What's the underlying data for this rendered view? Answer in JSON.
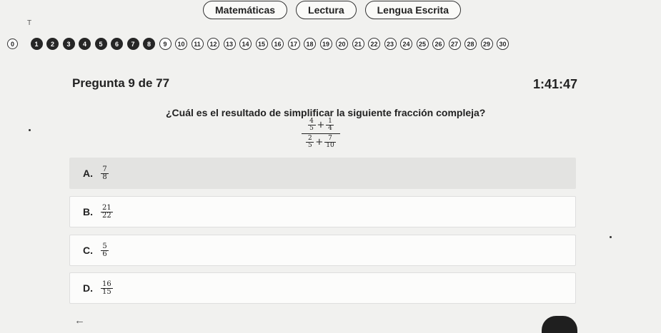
{
  "tabs": [
    "Matemáticas",
    "Lectura",
    "Lengua Escrita"
  ],
  "mark": "T",
  "progress": {
    "items": [
      {
        "label": "0",
        "state": "zero"
      },
      {
        "label": "1",
        "state": "done"
      },
      {
        "label": "2",
        "state": "done"
      },
      {
        "label": "3",
        "state": "done"
      },
      {
        "label": "4",
        "state": "done"
      },
      {
        "label": "5",
        "state": "done"
      },
      {
        "label": "6",
        "state": "done"
      },
      {
        "label": "7",
        "state": "done"
      },
      {
        "label": "8",
        "state": "done"
      },
      {
        "label": "9",
        "state": "pending"
      },
      {
        "label": "10",
        "state": "pending"
      },
      {
        "label": "11",
        "state": "pending"
      },
      {
        "label": "12",
        "state": "pending"
      },
      {
        "label": "13",
        "state": "pending"
      },
      {
        "label": "14",
        "state": "pending"
      },
      {
        "label": "15",
        "state": "pending"
      },
      {
        "label": "16",
        "state": "pending"
      },
      {
        "label": "17",
        "state": "pending"
      },
      {
        "label": "18",
        "state": "pending"
      },
      {
        "label": "19",
        "state": "pending"
      },
      {
        "label": "20",
        "state": "pending"
      },
      {
        "label": "21",
        "state": "pending"
      },
      {
        "label": "22",
        "state": "pending"
      },
      {
        "label": "23",
        "state": "pending"
      },
      {
        "label": "24",
        "state": "pending"
      },
      {
        "label": "25",
        "state": "pending"
      },
      {
        "label": "26",
        "state": "pending"
      },
      {
        "label": "27",
        "state": "pending"
      },
      {
        "label": "28",
        "state": "pending"
      },
      {
        "label": "29",
        "state": "pending"
      },
      {
        "label": "30",
        "state": "pending"
      }
    ]
  },
  "question": {
    "heading": "Pregunta 9 de 77",
    "timer": "1:41:47",
    "text": "¿Cuál es el resultado de simplificar la siguiente fracción compleja?",
    "expression": {
      "top": [
        {
          "num": "4",
          "den": "5"
        },
        {
          "num": "1",
          "den": "4"
        }
      ],
      "bottom": [
        {
          "num": "2",
          "den": "5"
        },
        {
          "num": "7",
          "den": "10"
        }
      ],
      "operator": "+"
    }
  },
  "options": [
    {
      "letter": "A.",
      "num": "7",
      "den": "8",
      "selected": true
    },
    {
      "letter": "B.",
      "num": "21",
      "den": "22",
      "selected": false
    },
    {
      "letter": "C.",
      "num": "5",
      "den": "6",
      "selected": false
    },
    {
      "letter": "D.",
      "num": "16",
      "den": "15",
      "selected": false
    }
  ],
  "nav": {
    "back_icon": "←"
  }
}
